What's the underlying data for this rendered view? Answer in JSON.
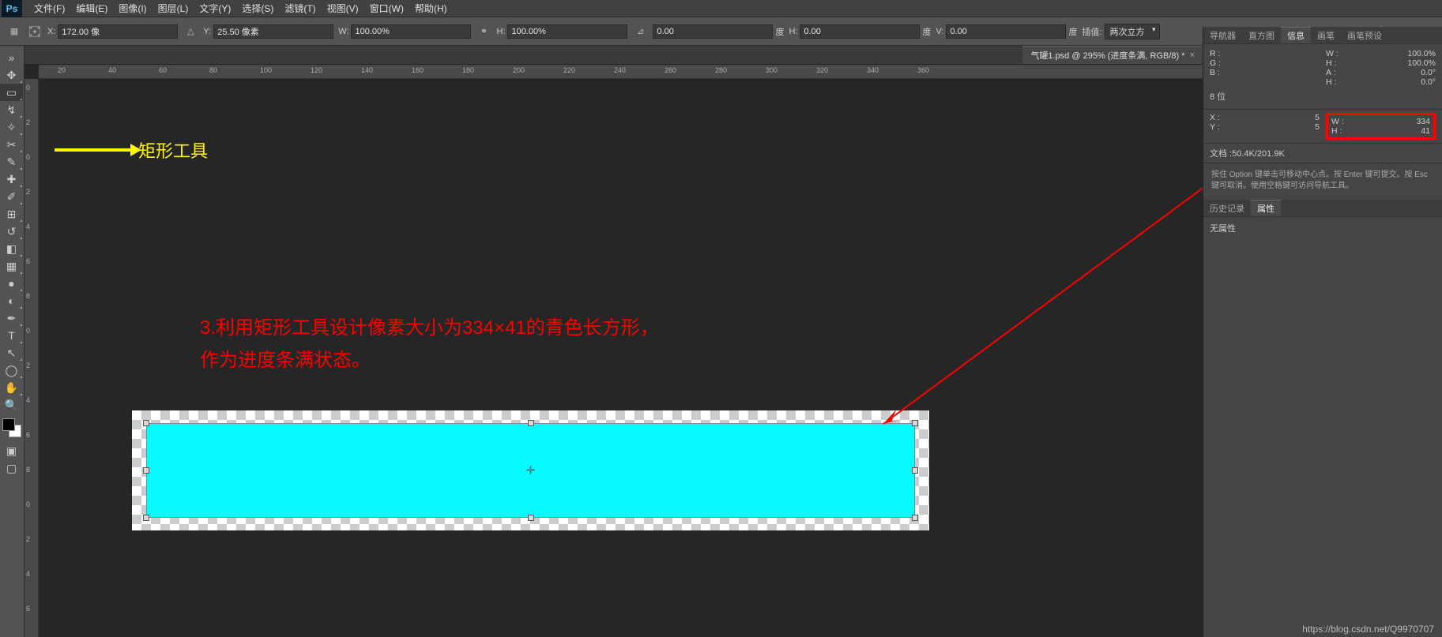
{
  "menu": {
    "file": "文件(F)",
    "edit": "编辑(E)",
    "image": "图像(I)",
    "layer": "图层(L)",
    "text": "文字(Y)",
    "select": "选择(S)",
    "filter": "滤镜(T)",
    "view": "视图(V)",
    "window": "窗口(W)",
    "help": "帮助(H)"
  },
  "options": {
    "x_label": "X:",
    "x": "172.00 像",
    "y_label": "Y:",
    "y": "25.50 像素",
    "w_label": "W:",
    "w": "100.00%",
    "h_label": "H:",
    "h": "100.00%",
    "angle_label": "",
    "angle": "0.00",
    "deg1": "度",
    "h2_label": "H:",
    "h2": "0.00",
    "deg2": "度",
    "v_label": "V:",
    "v": "0.00",
    "deg3": "度",
    "interp_label": "插值:",
    "interp": "两次立方"
  },
  "doc_tab": "气罐1.psd @ 295% (进度条满, RGB/8) *",
  "ruler_h": [
    "20",
    "40",
    "60",
    "80",
    "100",
    "120",
    "140",
    "160",
    "180",
    "200",
    "220",
    "240",
    "260",
    "280",
    "300",
    "320",
    "340",
    "360"
  ],
  "ruler_v": [
    "0",
    "2",
    "0",
    "2",
    "4",
    "6",
    "8",
    "0",
    "2",
    "4",
    "6",
    "8",
    "0",
    "2",
    "4",
    "6"
  ],
  "annotation_arrow": "矩形工具",
  "annotation_red_l1": "3.利用矩形工具设计像素大小为334×41的青色长方形，",
  "annotation_red_l2": "作为进度条满状态。",
  "info_panel": {
    "tabs": {
      "nav": "导航器",
      "hist": "直方图",
      "info": "信息",
      "brush": "画笔",
      "brushpre": "画笔预设"
    },
    "r": "R :",
    "g": "G :",
    "b": "B :",
    "w1": "W :",
    "w1v": "100.0%",
    "h1": "H :",
    "h1v": "100.0%",
    "a1": "A :",
    "a1v": "0.0°",
    "hh": "H :",
    "hhv": "0.0°",
    "bits": "8 位",
    "x": "X :",
    "xv": "5",
    "y": "Y :",
    "yv": "5",
    "w2": "W :",
    "w2v": "334",
    "h2": "H :",
    "h2v": "41",
    "doc": "文档 :50.4K/201.9K",
    "hint": "按住 Option 键单击可移动中心点。按 Enter 键可提交。按 Esc 键可取消。使用空格键可访问导航工具。"
  },
  "hist_panel": {
    "tabs": {
      "hist": "历史记录",
      "props": "属性"
    },
    "body": "无属性"
  },
  "footer": "https://blog.csdn.net/Q9970707"
}
